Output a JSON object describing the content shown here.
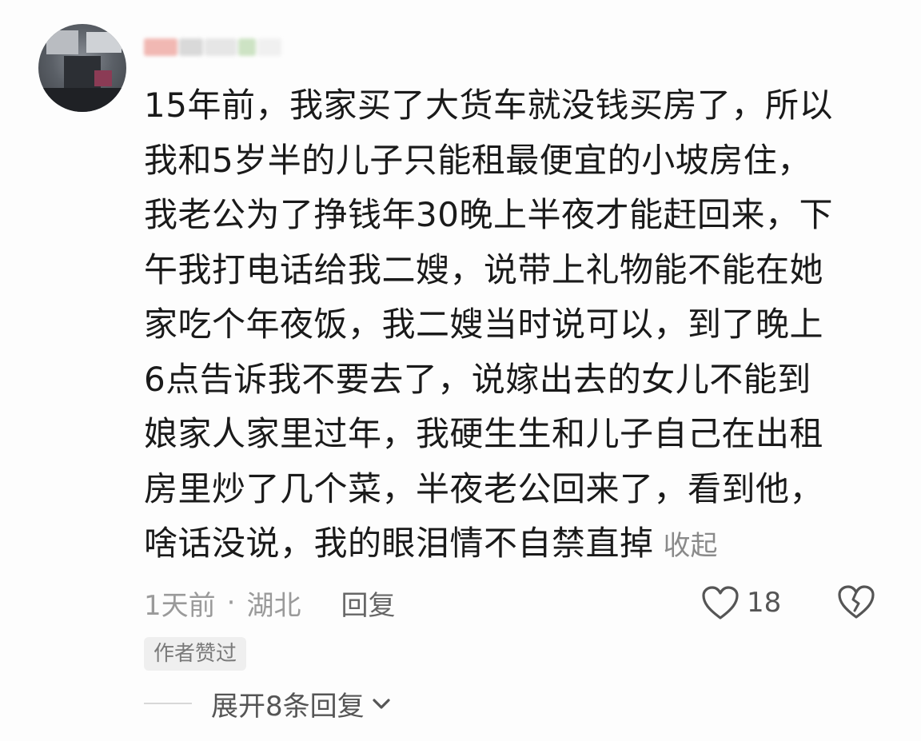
{
  "comment": {
    "lines": [
      "15年前，我家买了大货车就没钱买房了，所以",
      "我和5岁半的儿子只能租最便宜的小坡房住，",
      "我老公为了挣钱年30晚上半夜才能赶回来，下",
      "午我打电话给我二嫂，说带上礼物能不能在她",
      "家吃个年夜饭，我二嫂当时说可以，到了晚上",
      "6点告诉我不要去了，说嫁出去的女儿不能到",
      "娘家人家里过年，我硬生生和儿子自己在出租",
      "房里炒了几个菜，半夜老公回来了，看到他，",
      "啥话没说，我的眼泪情不自禁直掉"
    ],
    "collapse_label": "收起",
    "time": "1天前",
    "separator": "·",
    "location": "湖北",
    "reply_label": "回复",
    "like_count": "18",
    "author_liked_badge": "作者赞过",
    "expand_replies_label": "展开8条回复"
  },
  "icons": {
    "like": "heart-outline-icon",
    "dislike": "broken-heart-icon",
    "expand": "chevron-down-icon"
  },
  "colors": {
    "text": "#1a1a1a",
    "meta": "#9a9a9a",
    "badge_bg": "#efefef"
  }
}
